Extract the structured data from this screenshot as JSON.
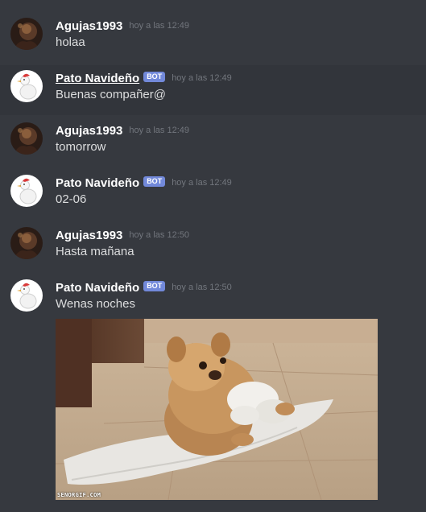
{
  "messages": [
    {
      "username": "Agujas1993",
      "bot": false,
      "bot_tag": "",
      "timestamp": "hoy a las 12:49",
      "content": "holaa",
      "avatar": "dark-avatar"
    },
    {
      "username": "Pato Navideño",
      "bot": true,
      "bot_tag": "BOT",
      "timestamp": "hoy a las 12:49",
      "content": "Buenas compañer@",
      "avatar": "duck-avatar"
    },
    {
      "username": "Agujas1993",
      "bot": false,
      "bot_tag": "",
      "timestamp": "hoy a las 12:49",
      "content": "tomorrow",
      "avatar": "dark-avatar"
    },
    {
      "username": "Pato Navideño",
      "bot": true,
      "bot_tag": "BOT",
      "timestamp": "hoy a las 12:49",
      "content": "02-06",
      "avatar": "duck-avatar"
    },
    {
      "username": "Agujas1993",
      "bot": false,
      "bot_tag": "",
      "timestamp": "hoy a las 12:50",
      "content": "Hasta mañana",
      "avatar": "dark-avatar"
    },
    {
      "username": "Pato Navideño",
      "bot": true,
      "bot_tag": "BOT",
      "timestamp": "hoy a las 12:50",
      "content": "Wenas noches",
      "avatar": "duck-avatar"
    }
  ],
  "embed": {
    "type": "gif",
    "subject": "pomeranian-puppy-gif",
    "watermark": "SENORGIF.COM"
  },
  "colors": {
    "background": "#36393f",
    "hover_row": "#32353b",
    "username": "#ffffff",
    "text": "#dcddde",
    "timestamp": "#72767d",
    "bot_tag": "#7289da"
  }
}
